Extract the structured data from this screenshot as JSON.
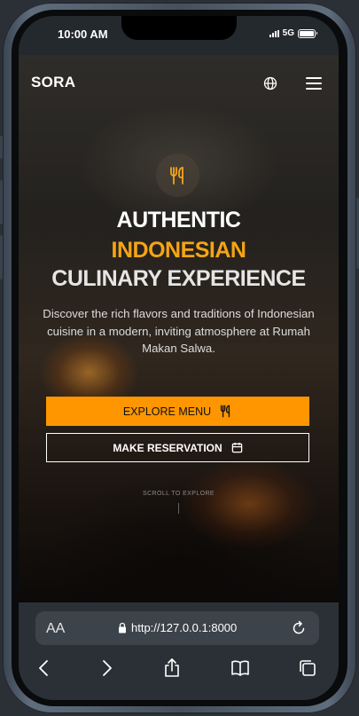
{
  "status_bar": {
    "time": "10:00 AM",
    "network": "5G"
  },
  "nav": {
    "logo": "SORA",
    "globe_icon": "globe-icon",
    "menu_icon": "hamburger-menu-icon"
  },
  "hero": {
    "badge_icon": "fork-knife-icon",
    "headline_line1": "AUTHENTIC",
    "headline_line2": "INDONESIAN",
    "headline_line3": "CULINARY EXPERIENCE",
    "description": "Discover the rich flavors and traditions of Indonesian cuisine in a modern, inviting atmosphere at Rumah Makan Salwa.",
    "primary_button": "EXPLORE MENU",
    "secondary_button": "MAKE RESERVATION",
    "scroll_hint": "SCROLL TO EXPLORE"
  },
  "browser": {
    "text_size_label": "AA",
    "url": "http://127.0.0.1:8000",
    "toolbar": [
      "back-icon",
      "forward-icon",
      "share-icon",
      "bookmarks-icon",
      "tabs-icon"
    ]
  },
  "colors": {
    "accent": "#ff9600",
    "headline_accent": "#f5a414"
  }
}
